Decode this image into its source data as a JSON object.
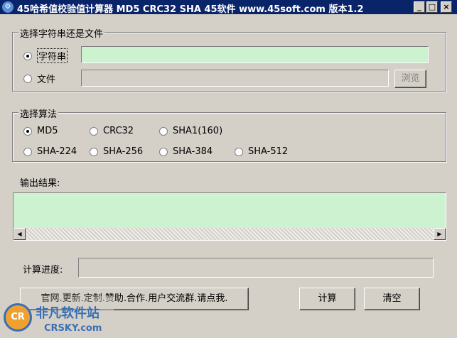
{
  "window": {
    "title": "45哈希值校验值计算器 MD5 CRC32 SHA 45软件 www.45soft.com 版本1.2",
    "controls": {
      "minimize": "_",
      "maximize": "□",
      "close": "×"
    },
    "app_icon": "gear-icon"
  },
  "source_group": {
    "title": "选择字符串还是文件",
    "string_option": {
      "label": "字符串",
      "checked": true
    },
    "string_value": "",
    "file_option": {
      "label": "文件",
      "checked": false
    },
    "file_value": "",
    "browse_label": "浏览"
  },
  "algorithm_group": {
    "title": "选择算法",
    "options": [
      {
        "label": "MD5",
        "checked": true
      },
      {
        "label": "CRC32",
        "checked": false
      },
      {
        "label": "SHA1(160)",
        "checked": false
      },
      {
        "label": "SHA-224",
        "checked": false
      },
      {
        "label": "SHA-256",
        "checked": false
      },
      {
        "label": "SHA-384",
        "checked": false
      },
      {
        "label": "SHA-512",
        "checked": false
      }
    ]
  },
  "output": {
    "label": "输出结果:",
    "value": ""
  },
  "progress": {
    "label": "计算进度:",
    "value": 0
  },
  "footer": {
    "promo_label": "官网.更新.定制.赞助.合作.用户交流群.请点我.",
    "compute_label": "计算",
    "clear_label": "清空"
  },
  "watermark": {
    "logo_text": "CR",
    "cn_text": "非凡软件站",
    "en_text": "CRSKY.com"
  },
  "colors": {
    "titlebar": "#0a246a",
    "field_green": "#ccf2d0",
    "window_bg": "#d4d0c8"
  }
}
